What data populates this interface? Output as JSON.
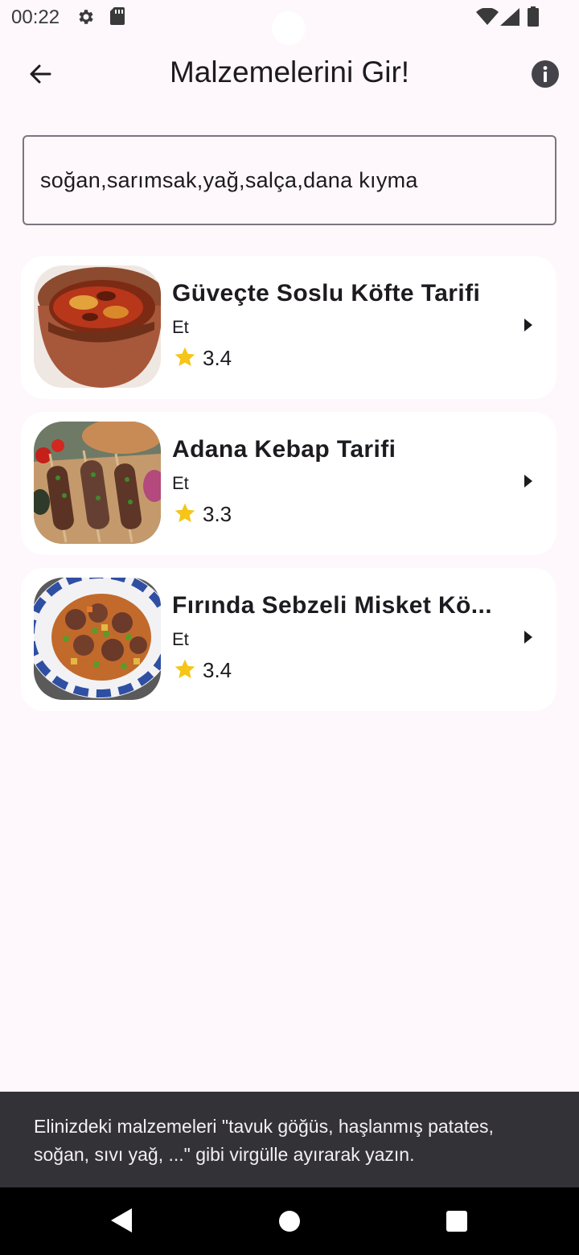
{
  "status_bar": {
    "time": "00:22"
  },
  "app_bar": {
    "title": "Malzemelerini Gir!",
    "back_icon": "arrow-back-icon",
    "info_icon": "info-icon"
  },
  "search": {
    "value": "soğan,sarımsak,yağ,salça,dana kıyma"
  },
  "recipes": [
    {
      "title": "Güveçte Soslu Köfte Tarifi",
      "category": "Et",
      "rating": "3.4"
    },
    {
      "title": "Adana Kebap Tarifi",
      "category": "Et",
      "rating": "3.3"
    },
    {
      "title": "Fırında Sebzeli Misket Kö...",
      "category": "Et",
      "rating": "3.4"
    }
  ],
  "snackbar": {
    "message": "Elinizdeki malzemeleri \"tavuk göğüs, haşlanmış patates, soğan, sıvı yağ, ...\" gibi virgülle ayırarak yazın."
  },
  "colors": {
    "background": "#fef7fb",
    "card": "#ffffff",
    "star": "#f5c518",
    "snackbar": "#333236"
  }
}
